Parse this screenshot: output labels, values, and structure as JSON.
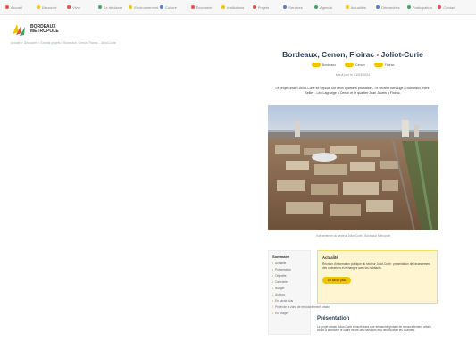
{
  "nav": {
    "items": [
      {
        "label": "Accueil",
        "color": "#e5534b"
      },
      {
        "label": "Découvrir",
        "color": "#f2c400"
      },
      {
        "label": "Vivre",
        "color": "#e5534b"
      },
      {
        "label": "Se déplacer",
        "color": "#46a35e"
      },
      {
        "label": "Environnement",
        "color": "#f2c400"
      },
      {
        "label": "Culture",
        "color": "#5a7bd8"
      },
      {
        "label": "Économie",
        "color": "#e5534b"
      },
      {
        "label": "Institutions",
        "color": "#f2c400"
      },
      {
        "label": "Projets",
        "color": "#e5534b"
      },
      {
        "label": "Services",
        "color": "#5a7bd8"
      },
      {
        "label": "Agenda",
        "color": "#46a35e"
      },
      {
        "label": "Actualités",
        "color": "#f2c400"
      },
      {
        "label": "Démarches",
        "color": "#5a7bd8"
      },
      {
        "label": "Participation",
        "color": "#46a35e"
      },
      {
        "label": "Contact",
        "color": "#e5534b"
      }
    ]
  },
  "brand": {
    "line1": "BORDEAUX",
    "line2": "MÉTROPOLE"
  },
  "breadcrumb": "Accueil > Découvrir > Grands projets > Bordeaux, Cenon, Floirac - Joliot-Curie",
  "page": {
    "title": "Bordeaux, Cenon, Floirac - Joliot-Curie",
    "tags": [
      "Bordeaux",
      "Cenon",
      "Floirac"
    ],
    "date": "Mis à jour le 01/03/2024",
    "intro": "Le projet urbain Joliot-Curie se déploie sur deux quartiers prioritaires : le secteur Benauge à Bordeaux, Henri Sellier - Léo Lagrange à Cenon et le quartier Jean Jaurès à Floirac.",
    "photo_caption": "Vue aérienne du secteur Joliot-Curie - Bordeaux Métropole"
  },
  "sidebar": {
    "heading": "Sommaire",
    "items": [
      "Actualité",
      "Présentation",
      "Objectifs",
      "Calendrier",
      "Budget",
      "Acteurs",
      "En savoir plus",
      "Projet de la zone de renouvellement urbain",
      "En images"
    ]
  },
  "callout": {
    "title": "Actualité",
    "text": "Réunion d'information publique du secteur Joliot-Curie : présentation de l'avancement des opérations et échanges avec les habitants.",
    "button": "En savoir plus"
  },
  "presentation": {
    "title": "Présentation",
    "text": "Le projet urbain Joliot-Curie s'inscrit dans une démarche globale de renouvellement urbain visant à améliorer le cadre de vie des habitants et à désenclaver les quartiers."
  },
  "colors": {
    "accent": "#f2c400",
    "title": "#2b3f55"
  }
}
